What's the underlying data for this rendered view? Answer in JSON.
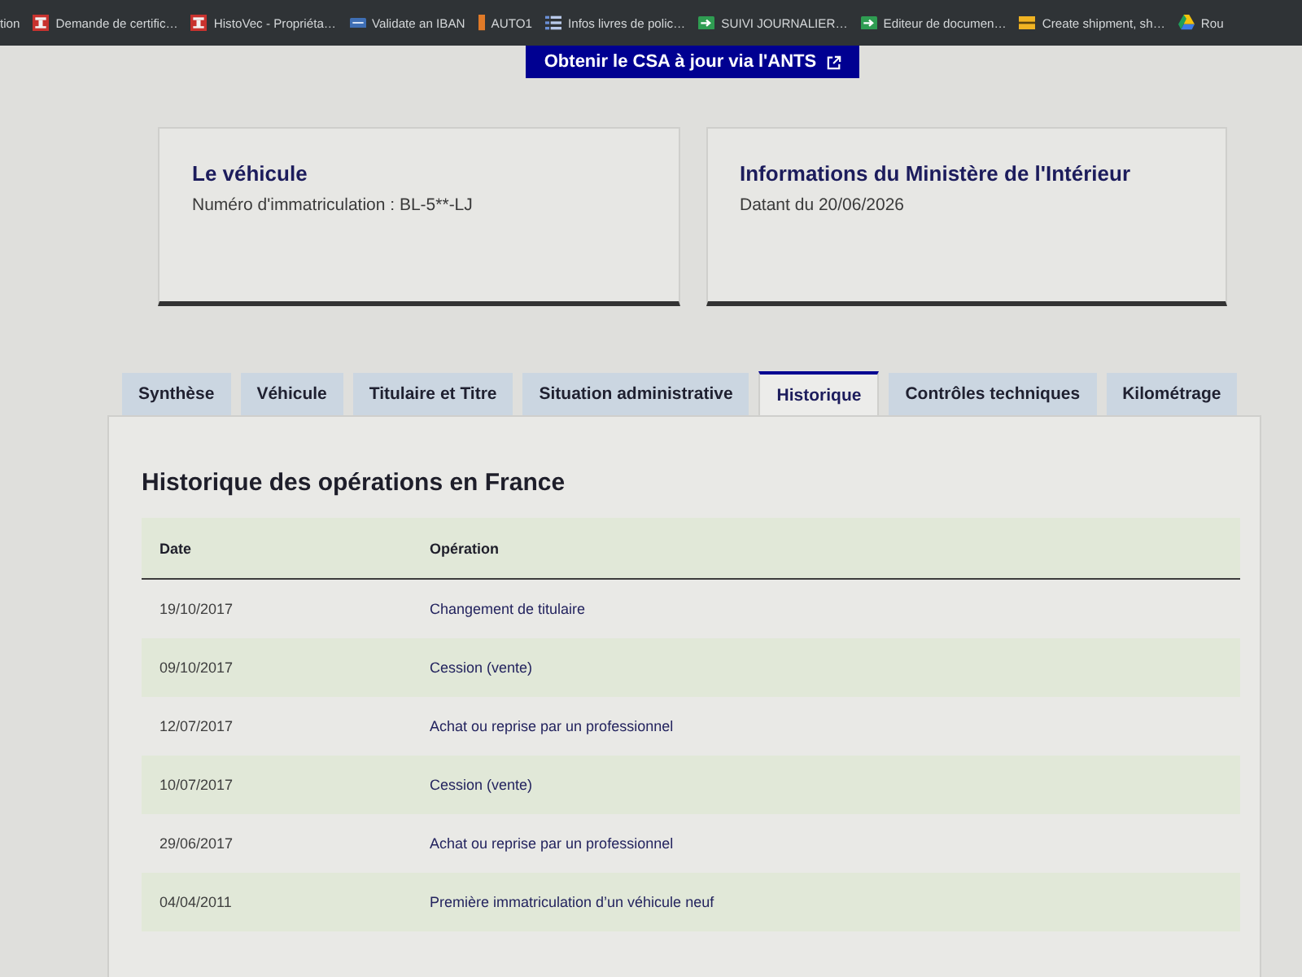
{
  "bookmarks_bar": {
    "items": [
      {
        "label": "tion",
        "kind": "plain"
      },
      {
        "label": "Demande de certific…",
        "kind": "emblem"
      },
      {
        "label": "HistoVec - Propriéta…",
        "kind": "emblem"
      },
      {
        "label": "Validate an IBAN",
        "kind": "card"
      },
      {
        "label": "AUTO1",
        "kind": "bar"
      },
      {
        "label": "Infos livres de polic…",
        "kind": "list"
      },
      {
        "label": "SUIVI JOURNALIER…",
        "kind": "sheet"
      },
      {
        "label": "Editeur de documen…",
        "kind": "sheet"
      },
      {
        "label": "Create shipment, sh…",
        "kind": "package"
      },
      {
        "label": "Rou",
        "kind": "triangle"
      }
    ]
  },
  "csa_button": {
    "label": "Obtenir le CSA à jour via l'ANTS"
  },
  "cards": [
    {
      "title": "Le véhicule",
      "text": "Numéro d'immatriculation : BL-5**-LJ"
    },
    {
      "title": "Informations du Ministère de l'Intérieur",
      "text": "Datant du 20/06/2026"
    }
  ],
  "tabs": [
    {
      "label": "Synthèse",
      "selected": false
    },
    {
      "label": "Véhicule",
      "selected": false
    },
    {
      "label": "Titulaire et Titre",
      "selected": false
    },
    {
      "label": "Situation administrative",
      "selected": false
    },
    {
      "label": "Historique",
      "selected": true
    },
    {
      "label": "Contrôles techniques",
      "selected": false
    },
    {
      "label": "Kilométrage",
      "selected": false
    }
  ],
  "history": {
    "title": "Historique des opérations en France",
    "table": {
      "columns": [
        "Date",
        "Opération"
      ],
      "rows": [
        [
          "19/10/2017",
          "Changement de titulaire"
        ],
        [
          "09/10/2017",
          "Cession (vente)"
        ],
        [
          "12/07/2017",
          "Achat ou reprise par un professionnel"
        ],
        [
          "10/07/2017",
          "Cession (vente)"
        ],
        [
          "29/06/2017",
          "Achat ou reprise par un professionnel"
        ],
        [
          "04/04/2011",
          "Première immatriculation d’un véhicule neuf"
        ]
      ]
    }
  }
}
